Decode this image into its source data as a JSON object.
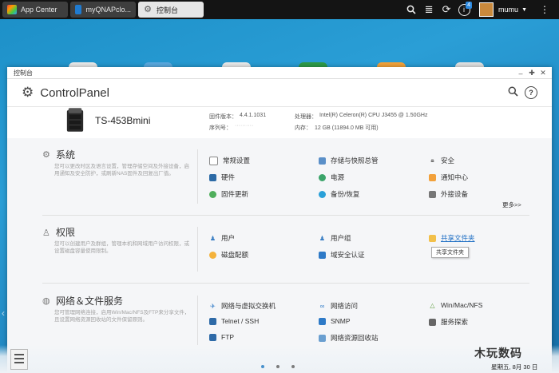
{
  "taskbar": {
    "tabs": [
      {
        "label": "App Center",
        "color": "#c85a9a"
      },
      {
        "label": "myQNAPclo...",
        "color": "#1f7bd0"
      },
      {
        "label": "控制台",
        "color": "#777777"
      }
    ],
    "notification_count": "4",
    "username": "mumu"
  },
  "window": {
    "title": "控制台",
    "app_title": "ControlPanel"
  },
  "device": {
    "model": "TS-453Bmini",
    "firmware_label": "固件版本：",
    "firmware_value": "4.4.1.1031",
    "serial_label": "序列号：",
    "serial_value": "··········",
    "cpu_label": "处理器：",
    "cpu_value": "Intel(R) Celeron(R) CPU J3455 @ 1.50GHz",
    "mem_label": "内存：",
    "mem_value": "12 GB (11894.0 MB 可用)"
  },
  "sections": {
    "system": {
      "title": "系统",
      "desc": "您可以更改时区及语言设置，管理存储空间及外接设备，启用通知及安全防护，或刷新NAS固件及回复出厂值。",
      "items": [
        "常规设置",
        "存储与快照总管",
        "安全",
        "硬件",
        "电源",
        "通知中心",
        "固件更新",
        "备份/恢复",
        "外接设备"
      ],
      "more": "更多>>"
    },
    "privilege": {
      "title": "权限",
      "desc": "您可以创建用户及群组，管理本机和网域用户访问权限，或设置磁盘容量使用限制。",
      "items": [
        "用户",
        "用户组",
        "共享文件夹",
        "磁盘配额",
        "域安全认证"
      ],
      "tooltip": "共享文件夹"
    },
    "network": {
      "title": "网络＆文件服务",
      "desc": "您可管理网络连接，启用Win/Mac/NFS及FTP来分享文件，且设置网络资源回收站的文件保留原则。",
      "items": [
        "网络与虚拟交换机",
        "网络访问",
        "Win/Mac/NFS",
        "Telnet / SSH",
        "SNMP",
        "服务探索",
        "FTP",
        "网络资源回收站"
      ]
    }
  },
  "watermark": "木玩数码",
  "date_text": "星期五, 8月 30 日",
  "colors": {
    "accent": "#1f6fc4",
    "desktop": "#2a9ed6"
  }
}
